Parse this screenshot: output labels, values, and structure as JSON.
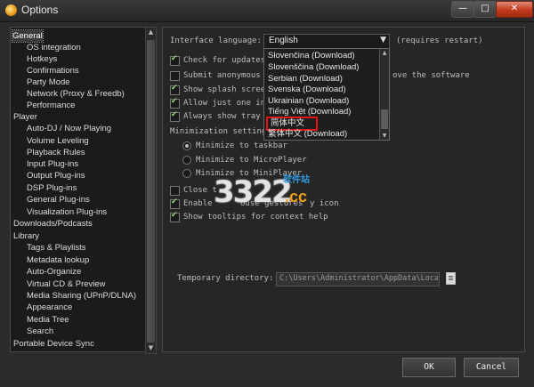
{
  "window": {
    "title": "Options",
    "minimize": "—",
    "maximize": "□",
    "close": "✕"
  },
  "sidebar": {
    "items": [
      {
        "label": "General",
        "selected": true
      },
      {
        "label": "OS integration"
      },
      {
        "label": "Hotkeys"
      },
      {
        "label": "Confirmations"
      },
      {
        "label": "Party Mode"
      },
      {
        "label": "Network (Proxy & Freedb)"
      },
      {
        "label": "Performance"
      },
      {
        "label": "Player"
      },
      {
        "label": "Auto-DJ / Now Playing"
      },
      {
        "label": "Volume Leveling"
      },
      {
        "label": "Playback Rules"
      },
      {
        "label": "Input Plug-ins"
      },
      {
        "label": "Output Plug-ins"
      },
      {
        "label": "DSP Plug-ins"
      },
      {
        "label": "General Plug-ins"
      },
      {
        "label": "Visualization Plug-ins"
      },
      {
        "label": "Downloads/Podcasts"
      },
      {
        "label": "Library"
      },
      {
        "label": "Tags & Playlists"
      },
      {
        "label": "Metadata lookup"
      },
      {
        "label": "Auto-Organize"
      },
      {
        "label": "Virtual CD & Preview"
      },
      {
        "label": "Media Sharing (UPnP/DLNA)"
      },
      {
        "label": "Appearance"
      },
      {
        "label": "Media Tree"
      },
      {
        "label": "Search"
      },
      {
        "label": "Portable Device Sync"
      }
    ]
  },
  "general": {
    "interface_language_label": "Interface language:",
    "language_value": "English",
    "requires_restart": "(requires restart)",
    "language_options": [
      "Slovenčina (Download)",
      "Slovenščina (Download)",
      "Serbian (Download)",
      "Svenska (Download)",
      "Ukrainian (Download)",
      "Tiếng Việt (Download)",
      "简体中文",
      "繁体中文 (Download)"
    ],
    "check_for_updates": "Check for updates",
    "submit_anonymous": "Submit anonymous u",
    "submit_anonymous_tail": "ove the software",
    "show_splash": "Show splash screen",
    "allow_one_instance": "Allow just one ins",
    "always_show_tray": "Always show tray i",
    "minimization_settings": "Minimization settings",
    "minimize_to_taskbar": "Minimize to taskbar",
    "minimize_to_microplayer": "Minimize to MicroPlayer",
    "minimize_to_miniplayer": "Minimize to MiniPlayer",
    "close_to_tray": "Close t",
    "enable_mouse_gestures": "Enable",
    "enable_mouse_gestures_mid": "ouse gestures",
    "enable_mouse_gestures_tail": "y icon",
    "show_tooltips": "Show tooltips for context help",
    "temporary_directory_label": "Temporary directory:",
    "temporary_directory_value": "C:\\Users\\Administrator\\AppData\\Local\\Temp"
  },
  "buttons": {
    "ok": "OK",
    "cancel": "Cancel"
  },
  "watermark": {
    "main": "3322",
    "cc": ".cc",
    "zh": "软件站"
  }
}
